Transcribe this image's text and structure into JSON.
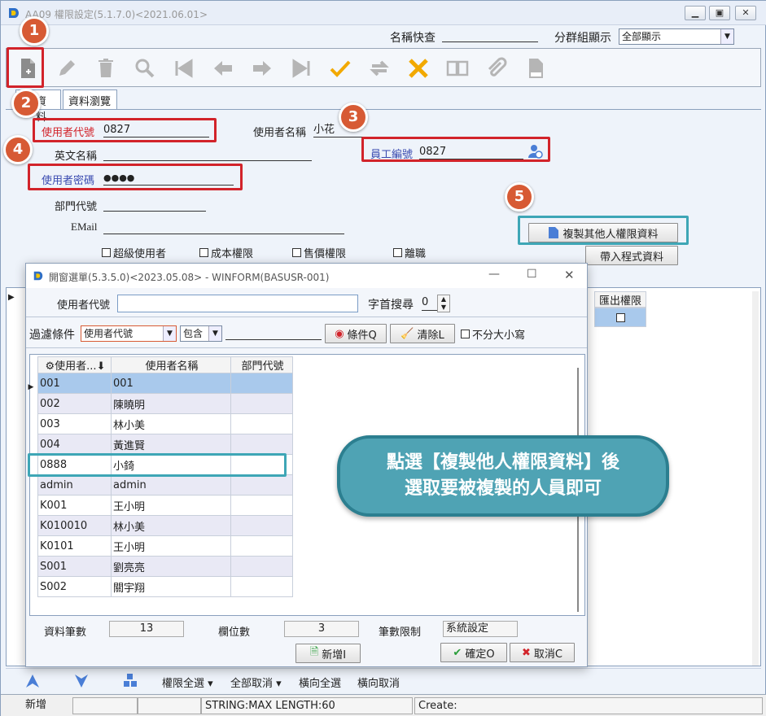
{
  "window": {
    "title": "AA09 權限設定(5.1.7.0)<2021.06.01>"
  },
  "topbar": {
    "name_quick_label": "名稱快查",
    "group_label": "分群組顯示",
    "group_value": "全部顯示"
  },
  "tabs": [
    "資料",
    "資料瀏覽"
  ],
  "form": {
    "user_id_label": "使用者代號",
    "user_id_value": "0827",
    "user_name_label": "使用者名稱",
    "user_name_value": "小花",
    "english_name_label": "英文名稱",
    "employee_no_label": "員工編號",
    "employee_no_value": "0827",
    "password_label": "使用者密碼",
    "password_value": "●●●●",
    "dept_label": "部門代號",
    "email_label": "EMail",
    "checkboxes": [
      "超級使用者",
      "成本權限",
      "售價權限",
      "離職"
    ],
    "copy_button": "複製其他人權限資料",
    "import_button": "帶入程式資料"
  },
  "main_grid": {
    "visible_header": "匯出權限"
  },
  "bottombar": {
    "items": [
      "權限全選",
      "全部取消",
      "橫向全選",
      "橫向取消"
    ]
  },
  "status": {
    "mode": "新增",
    "hint": "STRING:MAX LENGTH:60",
    "create": "Create:"
  },
  "dialog": {
    "title": "開窗選單(5.3.5.0)<2023.05.08> - WINFORM(BASUSR-001)",
    "user_id_label": "使用者代號",
    "first_char_label": "字首搜尋",
    "first_char_value": "0",
    "filter_label": "過濾條件",
    "filter_field": "使用者代號",
    "filter_op": "包含",
    "condition_button": "條件Q",
    "clear_button": "清除L",
    "case_label": "不分大小寫",
    "columns": [
      "使用者...",
      "使用者名稱",
      "部門代號"
    ],
    "rows": [
      {
        "id": "001",
        "name": "001"
      },
      {
        "id": "002",
        "name": "陳曉明"
      },
      {
        "id": "003",
        "name": "林小美"
      },
      {
        "id": "004",
        "name": "黃進賢"
      },
      {
        "id": "0888",
        "name": "小錡"
      },
      {
        "id": "admin",
        "name": "admin"
      },
      {
        "id": "K001",
        "name": "王小明"
      },
      {
        "id": "K010010",
        "name": "林小美"
      },
      {
        "id": "K0101",
        "name": "王小明"
      },
      {
        "id": "S001",
        "name": "劉亮亮"
      },
      {
        "id": "S002",
        "name": "關宇翔"
      }
    ],
    "record_count_label": "資料筆數",
    "record_count": "13",
    "field_count_label": "欄位數",
    "field_count": "3",
    "limit_label": "筆數限制",
    "limit_value": "系統設定",
    "add_button": "新增I",
    "ok_button": "確定O",
    "cancel_button": "取消C"
  },
  "callout": {
    "line1": "點選【複製他人權限資料】後",
    "line2": "選取要被複製的人員即可"
  },
  "badges": [
    "1",
    "2",
    "3",
    "4",
    "5"
  ]
}
